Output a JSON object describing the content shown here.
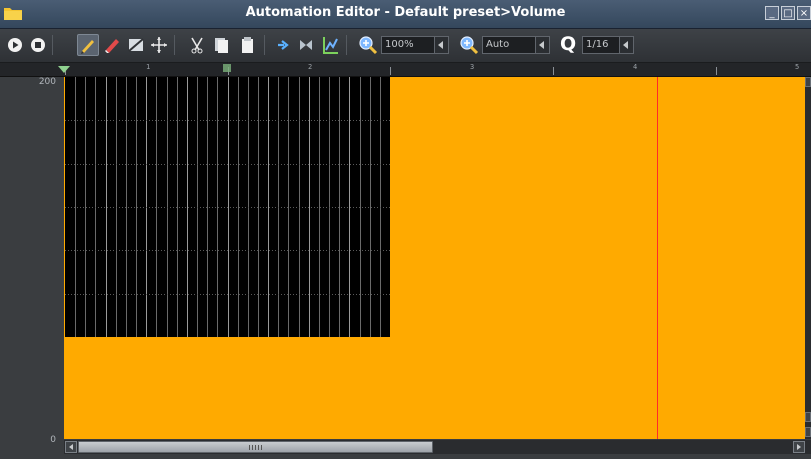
{
  "window": {
    "title": "Automation Editor - Default preset>Volume",
    "controls": [
      "minimize-icon",
      "maximize-icon",
      "close-icon"
    ]
  },
  "toolbar": {
    "play_icon": "play-icon",
    "stop_icon": "stop-icon",
    "draw_icon": "pencil-icon",
    "erase_icon": "eraser-icon",
    "select_icon": "select-icon",
    "move_icon": "move-icon",
    "cut_icon": "scissors-icon",
    "copy_icon": "copy-icon",
    "paste_icon": "paste-icon",
    "discrete_icon": "discrete-progression-icon",
    "linear_icon": "linear-progression-icon",
    "cubic_icon": "cubic-hermite-icon",
    "zoom_x_value": "100%",
    "zoom_y_value": "Auto",
    "quantize_label": "Q",
    "quantize_value": "1/16",
    "active_tool": "draw"
  },
  "ruler": {
    "bars": [
      "1",
      "2",
      "3",
      "4",
      "5"
    ]
  },
  "axis": {
    "max_label": "200",
    "min_label": "0"
  },
  "colors": {
    "automation_fill": "#ffaa00",
    "playhead": "#ff2a2a",
    "grid_background": "#000000",
    "position_marker": "#8fd18f"
  }
}
